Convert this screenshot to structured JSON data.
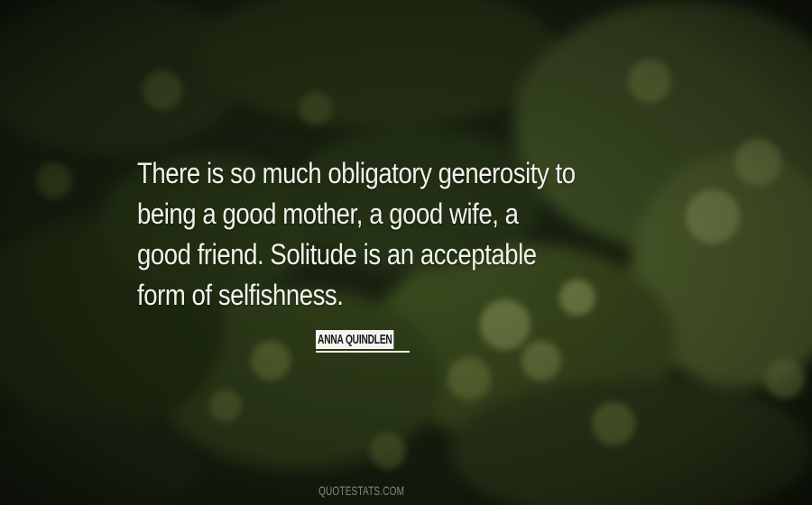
{
  "quote": {
    "lines": [
      "There is so much obligatory generosity to",
      "being a good mother, a good wife, a",
      "good friend. Solitude is an acceptable",
      "form of selfishness."
    ]
  },
  "author": "ANNA QUINDLEN",
  "watermark": "QUOTESTATS.COM",
  "colors": {
    "text": "#f2f2ea",
    "background_dark": "#1c2613",
    "foliage": "#8fa05a"
  }
}
